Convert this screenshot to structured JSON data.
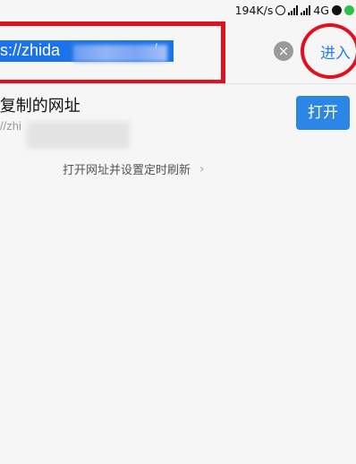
{
  "status_bar": {
    "speed": "194K/s",
    "network": "4G"
  },
  "url_bar": {
    "url_visible_start": "s://zhida",
    "url_visible_end": "/",
    "clear_symbol": "×",
    "enter_label": "进入"
  },
  "suggestion": {
    "title": "复制的网址",
    "url": "//zhi",
    "open_label": "打开"
  },
  "tip": {
    "text": "打开网址并设置定时刷新",
    "chevron": "›"
  },
  "colors": {
    "accent": "#2b86e6",
    "annotation_red": "#e0101e",
    "selection": "#1a73e8"
  }
}
